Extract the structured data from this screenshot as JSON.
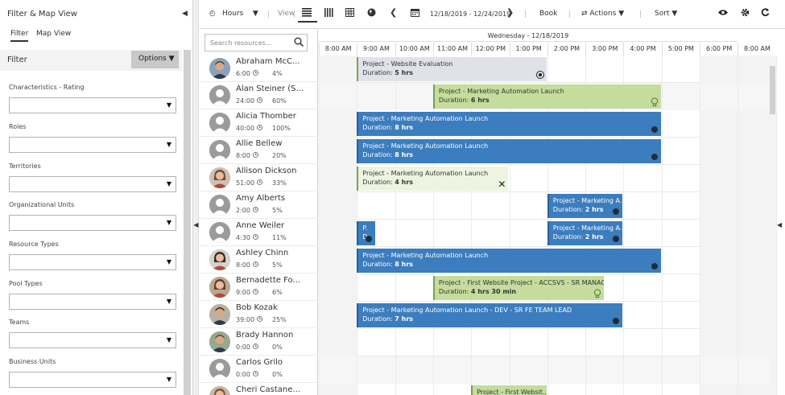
{
  "filter_pane": {
    "title": "Filter & Map View",
    "tabs": [
      {
        "label": "Filter",
        "active": true
      },
      {
        "label": "Map View",
        "active": false
      }
    ],
    "filter_label": "Filter",
    "options_label": "Options",
    "sections": [
      {
        "label": "Characteristics - Rating"
      },
      {
        "label": "Roles"
      },
      {
        "label": "Territories"
      },
      {
        "label": "Organizational Units"
      },
      {
        "label": "Resource Types"
      },
      {
        "label": "Pool Types"
      },
      {
        "label": "Teams"
      },
      {
        "label": "Business Units"
      }
    ]
  },
  "toolbar": {
    "hours_label": "Hours",
    "view_label": "View",
    "date_range": "12/18/2019 - 12/24/2019",
    "book_label": "Book",
    "actions_label": "Actions",
    "sort_label": "Sort"
  },
  "search": {
    "placeholder": "Search resources..."
  },
  "schedule": {
    "date_header": "Wednesday - 12/18/2019",
    "hours": [
      "8:00 AM",
      "9:00 AM",
      "10:00 AM",
      "11:00 AM",
      "12:00 PM",
      "1:00 PM",
      "2:00 PM",
      "3:00 PM",
      "4:00 PM",
      "5:00 PM",
      "6:00 PM",
      "8:00 AM"
    ]
  },
  "resources": [
    {
      "name": "Abraham McC...",
      "hours": "6:00",
      "pct": "4%",
      "avatar": "photo-man-1"
    },
    {
      "name": "Alan Steiner (S...",
      "hours": "24:00",
      "pct": "60%",
      "avatar": "default"
    },
    {
      "name": "Alicia Thomber",
      "hours": "40:00",
      "pct": "100%",
      "avatar": "default"
    },
    {
      "name": "Allie Bellew",
      "hours": "8:00",
      "pct": "20%",
      "avatar": "default"
    },
    {
      "name": "Allison Dickson",
      "hours": "51:00",
      "pct": "33%",
      "avatar": "photo-woman-1"
    },
    {
      "name": "Amy Alberts",
      "hours": "2:00",
      "pct": "5%",
      "avatar": "default"
    },
    {
      "name": "Anne Weiler",
      "hours": "4:30",
      "pct": "11%",
      "avatar": "default"
    },
    {
      "name": "Ashley Chinn",
      "hours": "8:00",
      "pct": "5%",
      "avatar": "photo-woman-2"
    },
    {
      "name": "Bernadette Fo...",
      "hours": "9:00",
      "pct": "6%",
      "avatar": "photo-woman-3"
    },
    {
      "name": "Bob Kozak",
      "hours": "39:00",
      "pct": "25%",
      "avatar": "photo-man-2"
    },
    {
      "name": "Brady Hannon",
      "hours": "0:00",
      "pct": "0%",
      "avatar": "photo-man-3"
    },
    {
      "name": "Carlos Grilo",
      "hours": "0:00",
      "pct": "0%",
      "avatar": "default"
    },
    {
      "name": "Cheri Castane...",
      "hours": "",
      "pct": "",
      "avatar": "photo-woman-4"
    }
  ],
  "bookings": [
    {
      "title": "Project - Website Evaluation",
      "duration_label": "Duration:",
      "duration": "5 hrs",
      "style": "grey",
      "indicator": "ring"
    },
    {
      "title": "Project - Marketing Automation Launch",
      "duration_label": "Duration:",
      "duration": "6 hrs",
      "style": "green",
      "indicator": "bulb"
    },
    {
      "title": "Project - Marketing Automation Launch",
      "duration_label": "Duration:",
      "duration": "8 hrs",
      "style": "blue",
      "indicator": "dot"
    },
    {
      "title": "Project - Marketing Automation Launch",
      "duration_label": "Duration:",
      "duration": "8 hrs",
      "style": "blue",
      "indicator": "dot"
    },
    {
      "title": "Project - Marketing Automation Launch",
      "duration_label": "Duration:",
      "duration": "4 hrs",
      "style": "light",
      "indicator": "x"
    },
    {
      "title": "Project - Marketing A...",
      "duration_label": "Duration:",
      "duration": "2 hrs",
      "style": "blue",
      "indicator": "dot"
    },
    {
      "title": "P.",
      "duration_label": "D",
      "duration": "",
      "style": "blue",
      "indicator": "dot"
    },
    {
      "title": "Project - Marketing A...",
      "duration_label": "Duration:",
      "duration": "2 hrs",
      "style": "blue",
      "indicator": "dot"
    },
    {
      "title": "Project - Marketing Automation Launch",
      "duration_label": "Duration:",
      "duration": "8 hrs",
      "style": "blue",
      "indicator": "dot"
    },
    {
      "title": "Project - First Website Project - ACCSVS - SR MANAGER",
      "duration_label": "Duration:",
      "duration": "4 hrs 30 min",
      "style": "green",
      "indicator": "bulb"
    },
    {
      "title": "Project - Marketing Automation Launch - DEV - SR FE TEAM LEAD",
      "duration_label": "Duration:",
      "duration": "7 hrs",
      "style": "blue",
      "indicator": "dot"
    },
    {
      "title": "Project - First Websit...",
      "duration_label": "",
      "duration": "",
      "style": "green",
      "indicator": "none"
    }
  ],
  "colors": {
    "booking_blue": "#3b7dbe",
    "booking_green": "#c4dd9c",
    "booking_grey": "#dfe3e9",
    "booking_light": "#edf5e1",
    "offhours": "#f3f3f3"
  }
}
